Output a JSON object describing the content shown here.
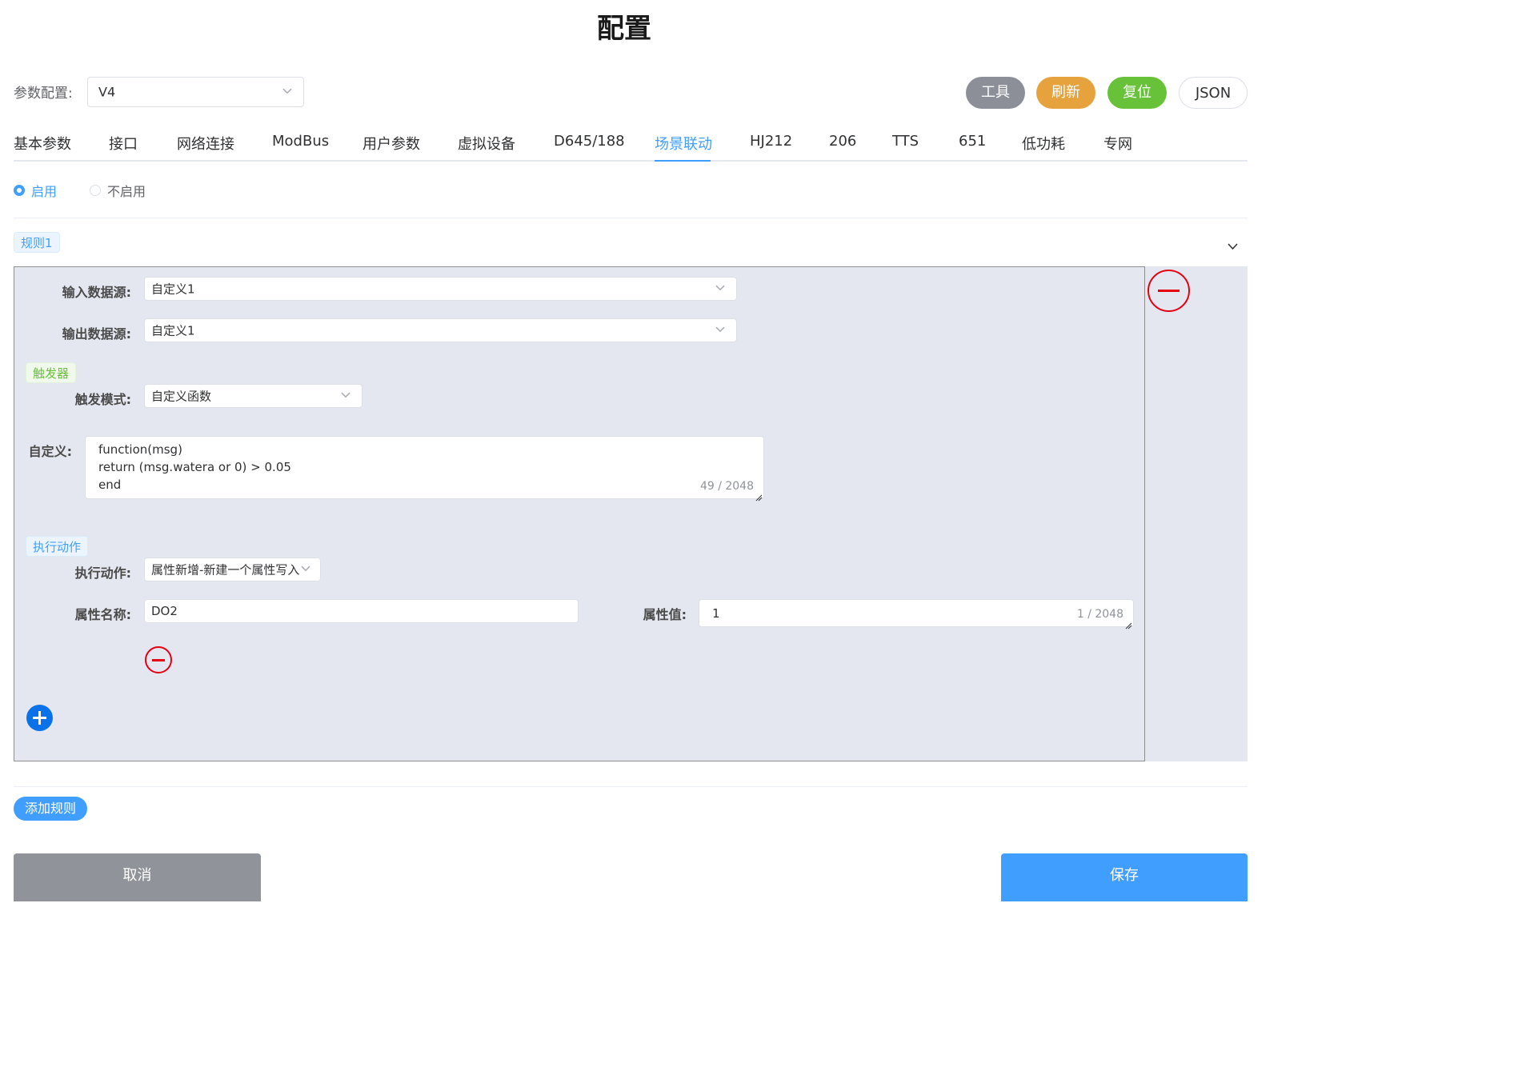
{
  "page": {
    "title": "配置"
  },
  "config": {
    "label": "参数配置:",
    "value": "V4"
  },
  "toolbar": {
    "tools_label": "工具",
    "refresh_label": "刷新",
    "reset_label": "复位",
    "json_label": "JSON",
    "colors": {
      "tools": "#8c8f98",
      "refresh": "#e6a23c",
      "reset": "#67c23a"
    }
  },
  "tabs": [
    {
      "label": "基本参数"
    },
    {
      "label": "接口"
    },
    {
      "label": "网络连接"
    },
    {
      "label": "ModBus"
    },
    {
      "label": "用户参数"
    },
    {
      "label": "虚拟设备"
    },
    {
      "label": "D645/188"
    },
    {
      "label": "场景联动",
      "active": true
    },
    {
      "label": "HJ212"
    },
    {
      "label": "206"
    },
    {
      "label": "TTS"
    },
    {
      "label": "651"
    },
    {
      "label": "低功耗"
    },
    {
      "label": "专网"
    }
  ],
  "enable": {
    "on_label": "启用",
    "off_label": "不启用",
    "selected": "启用"
  },
  "rule": {
    "title": "规则1",
    "input_source": {
      "label": "输入数据源:",
      "value": "自定义1"
    },
    "output_source": {
      "label": "输出数据源:",
      "value": "自定义1"
    },
    "trigger": {
      "tag": "触发器",
      "mode_label": "触发模式:",
      "mode_value": "自定义函数",
      "custom_label": "自定义:",
      "code_lines": [
        "function(msg)",
        "return (msg.watera or 0) > 0.05",
        "end"
      ],
      "counter": "49 / 2048"
    },
    "action": {
      "tag": "执行动作",
      "action_label": "执行动作:",
      "action_value": "属性新增-新建一个属性写入",
      "attr_name_label": "属性名称:",
      "attr_name_value": "DO2",
      "attr_value_label": "属性值:",
      "attr_value_value": "1",
      "attr_value_counter": "1 / 2048"
    }
  },
  "footer": {
    "add_rule_label": "添加规则",
    "cancel_label": "取消",
    "save_label": "保存"
  }
}
